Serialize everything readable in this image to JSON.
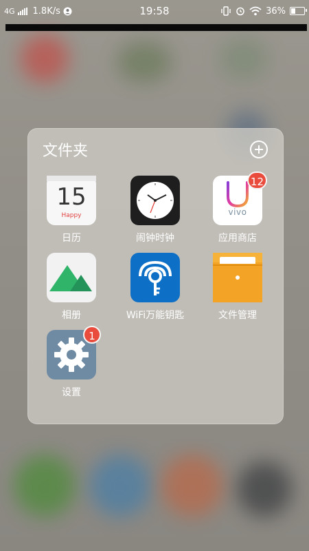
{
  "status_bar": {
    "network": "4G",
    "speed": "1.8K/s",
    "time": "19:58",
    "battery": "36%",
    "battery_level": 0.36
  },
  "folder": {
    "title": "文件夹",
    "add_icon": "plus-circle-icon"
  },
  "apps": [
    {
      "label": "日历",
      "icon": "calendar-icon",
      "day": "15",
      "day_caption": "Happy"
    },
    {
      "label": "闹钟时钟",
      "icon": "clock-icon"
    },
    {
      "label": "应用商店",
      "icon": "app-store-icon",
      "badge": "12",
      "brand": "vivo"
    },
    {
      "label": "相册",
      "icon": "gallery-icon"
    },
    {
      "label": "WiFi万能钥匙",
      "icon": "wifi-key-icon"
    },
    {
      "label": "文件管理",
      "icon": "file-manager-icon"
    },
    {
      "label": "设置",
      "icon": "settings-gear-icon",
      "badge": "1"
    }
  ],
  "colors": {
    "badge": "#e94b3c",
    "clock_bg": "#1e1e1e",
    "wifi_bg": "#0d6fc5",
    "files_bg": "#f3a325",
    "settings_bg": "#6f8aa3",
    "gallery_green": "#2fb46a"
  }
}
